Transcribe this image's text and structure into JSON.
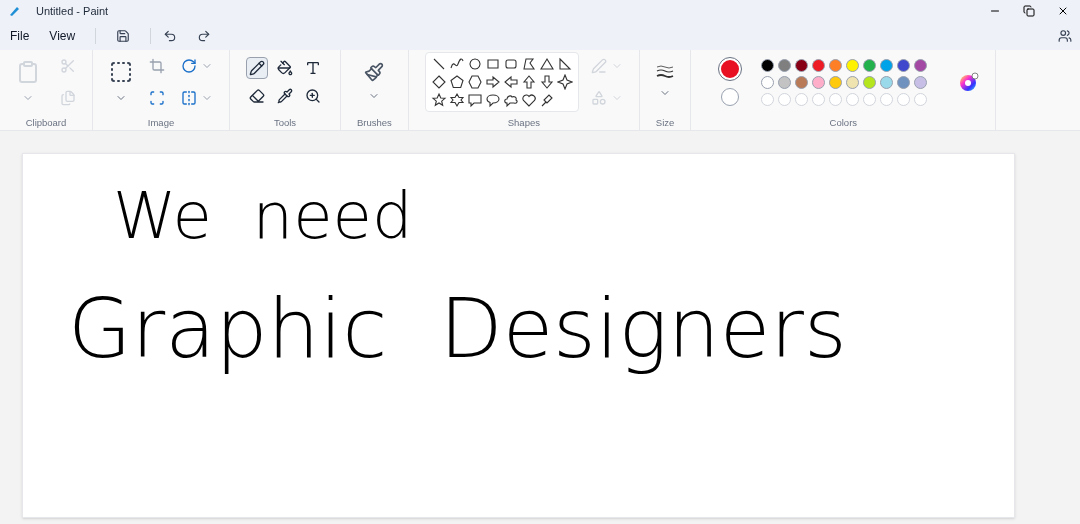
{
  "window": {
    "title": "Untitled - Paint"
  },
  "menu": [
    {
      "label": "File"
    },
    {
      "label": "View"
    }
  ],
  "ribbon": {
    "groups": [
      {
        "kind": "clipboard",
        "label": "Clipboard"
      },
      {
        "kind": "image",
        "label": "Image"
      },
      {
        "kind": "tools",
        "label": "Tools",
        "tools": [
          {
            "kind": "pencil",
            "selected": true
          },
          {
            "kind": "fill",
            "selected": false
          },
          {
            "kind": "text",
            "selected": false
          },
          {
            "kind": "eraser",
            "selected": false
          },
          {
            "kind": "picker",
            "selected": false
          },
          {
            "kind": "zoom",
            "selected": false
          }
        ]
      },
      {
        "kind": "brushes",
        "label": "Brushes"
      },
      {
        "kind": "shapes",
        "label": "Shapes",
        "shapes": [
          {
            "kind": "line"
          },
          {
            "kind": "curve"
          },
          {
            "kind": "oval"
          },
          {
            "kind": "rect"
          },
          {
            "kind": "roundrect"
          },
          {
            "kind": "polygon"
          },
          {
            "kind": "triangle"
          },
          {
            "kind": "righttri"
          },
          {
            "kind": "diamond"
          },
          {
            "kind": "pentagon"
          },
          {
            "kind": "hexagon"
          },
          {
            "kind": "arrowright"
          },
          {
            "kind": "arrowleft"
          },
          {
            "kind": "arrowup"
          },
          {
            "kind": "arrowdown"
          },
          {
            "kind": "star4"
          },
          {
            "kind": "star5"
          },
          {
            "kind": "star6"
          },
          {
            "kind": "calloutrect"
          },
          {
            "kind": "calloutoval"
          },
          {
            "kind": "calloutcloud"
          },
          {
            "kind": "heart"
          },
          {
            "kind": "pin"
          }
        ]
      },
      {
        "kind": "size",
        "label": "Size"
      },
      {
        "kind": "colors",
        "label": "Colors",
        "primary": {
          "color": "#e81123"
        },
        "secondary": {
          "color": "#ffffff"
        },
        "palette": [
          {
            "color": "#000000"
          },
          {
            "color": "#7f7f7f"
          },
          {
            "color": "#880015"
          },
          {
            "color": "#ed1c24"
          },
          {
            "color": "#ff7f27"
          },
          {
            "color": "#fff200"
          },
          {
            "color": "#22b14c"
          },
          {
            "color": "#00a2e8"
          },
          {
            "color": "#3f48cc"
          },
          {
            "color": "#a349a4"
          },
          {
            "color": "#ffffff"
          },
          {
            "color": "#c3c3c3"
          },
          {
            "color": "#b97a57"
          },
          {
            "color": "#ffaec9"
          },
          {
            "color": "#ffc90e"
          },
          {
            "color": "#efe4b0"
          },
          {
            "color": "#b5e61d"
          },
          {
            "color": "#99d9ea"
          },
          {
            "color": "#7092be"
          },
          {
            "color": "#c8bfe7"
          },
          {
            "kind": "empty"
          },
          {
            "kind": "empty"
          },
          {
            "kind": "empty"
          },
          {
            "kind": "empty"
          },
          {
            "kind": "empty"
          },
          {
            "kind": "empty"
          },
          {
            "kind": "empty"
          },
          {
            "kind": "empty"
          },
          {
            "kind": "empty"
          },
          {
            "kind": "empty"
          }
        ]
      }
    ]
  },
  "canvas": {
    "lines": [
      "We  need",
      "Graphic  Designers"
    ]
  }
}
